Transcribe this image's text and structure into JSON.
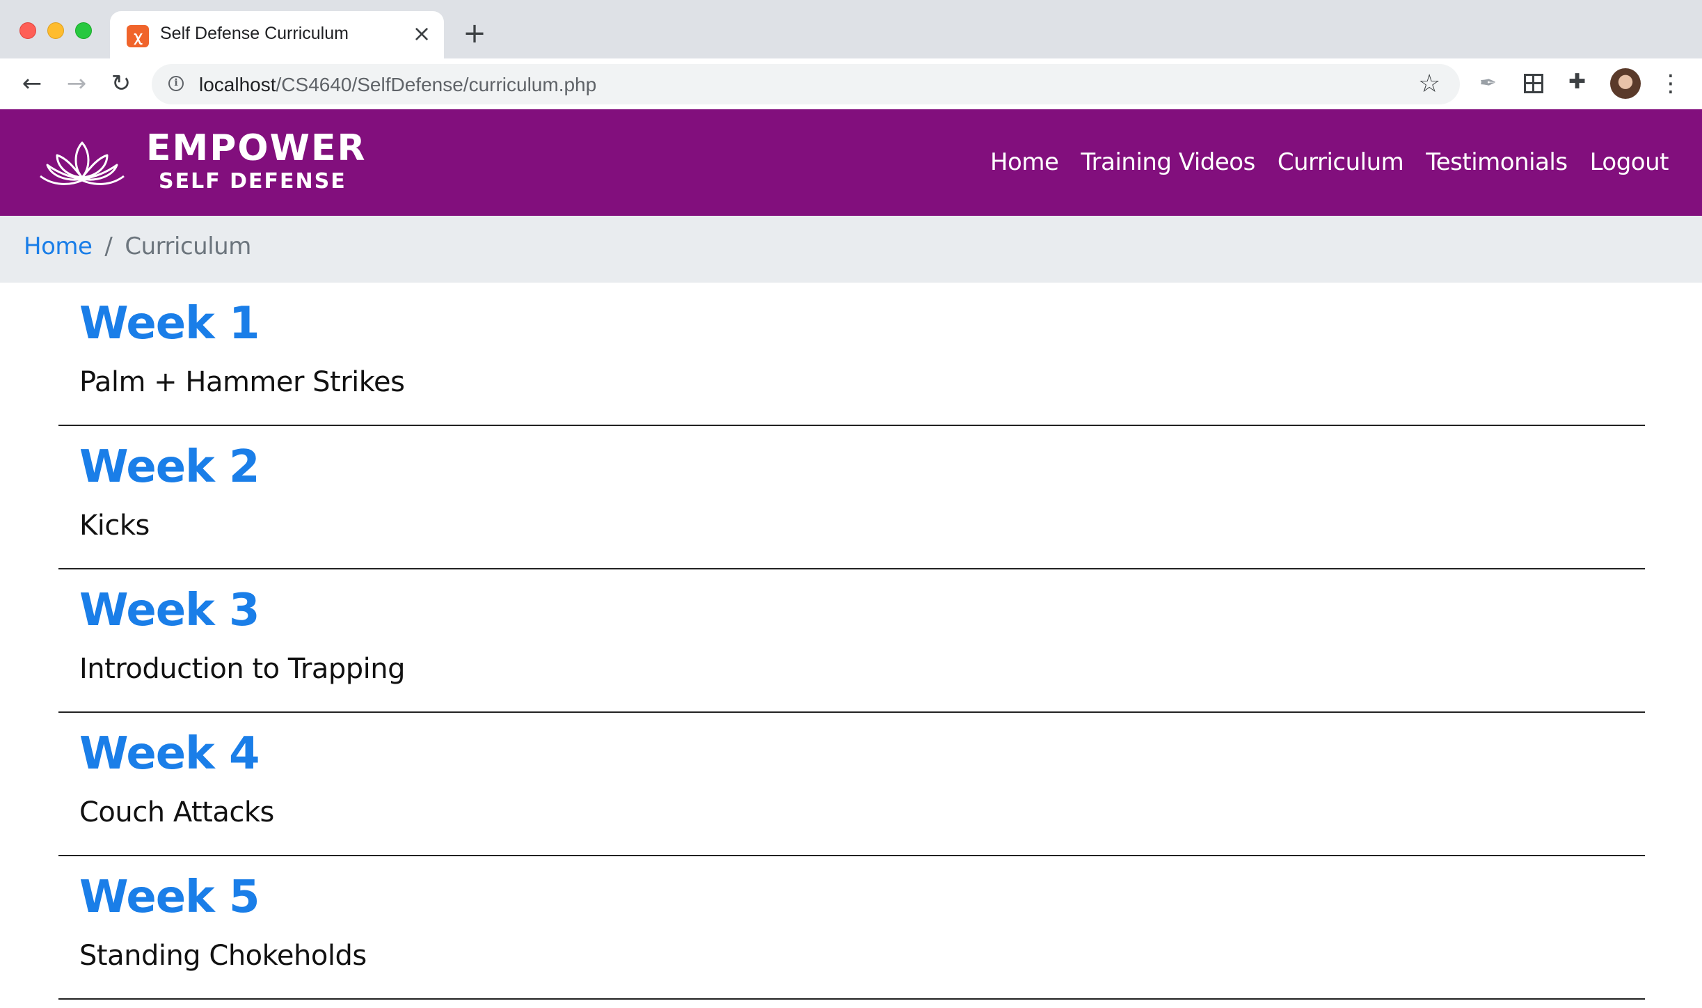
{
  "browser": {
    "tab_title": "Self Defense Curriculum",
    "tab_close": "×",
    "new_tab": "+",
    "url_host": "localhost",
    "url_path": "/CS4640/SelfDefense/curriculum.php",
    "icons": [
      "back-arrow-icon",
      "forward-arrow-icon",
      "reload-icon",
      "info-icon",
      "star-icon",
      "feather-extension-icon",
      "grid-extension-icon",
      "puzzle-extension-icon",
      "avatar",
      "more-vert-icon"
    ]
  },
  "site": {
    "brand_line1": "EMPOWER",
    "brand_line2": "SELF DEFENSE",
    "brand_color": "#820f7d",
    "nav": [
      "Home",
      "Training Videos",
      "Curriculum",
      "Testimonials",
      "Logout"
    ]
  },
  "breadcrumb": {
    "home": "Home",
    "separator": "/",
    "current": "Curriculum"
  },
  "weeks": [
    {
      "title": "Week 1",
      "topic": "Palm + Hammer Strikes"
    },
    {
      "title": "Week 2",
      "topic": "Kicks"
    },
    {
      "title": "Week 3",
      "topic": "Introduction to Trapping"
    },
    {
      "title": "Week 4",
      "topic": "Couch Attacks"
    },
    {
      "title": "Week 5",
      "topic": "Standing Chokeholds"
    }
  ],
  "accent_color": "#1a7ee8"
}
